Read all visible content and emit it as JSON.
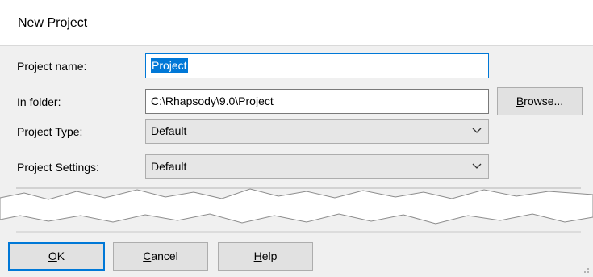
{
  "dialog": {
    "title": "New Project"
  },
  "fields": {
    "project_name_label": "Project name:",
    "project_name_value": "Project",
    "in_folder_label": "In folder:",
    "in_folder_value": "C:\\Rhapsody\\9.0\\Project",
    "project_type_label": "Project Type:",
    "project_type_value": "Default",
    "project_settings_label": "Project Settings:",
    "project_settings_value": "Default"
  },
  "buttons": {
    "browse": {
      "before": "",
      "mnemonic": "B",
      "after": "rowse..."
    },
    "ok": {
      "before": "",
      "mnemonic": "O",
      "after": "K"
    },
    "cancel": {
      "before": "",
      "mnemonic": "C",
      "after": "ancel"
    },
    "help": {
      "before": "",
      "mnemonic": "H",
      "after": "elp"
    }
  },
  "colors": {
    "accent": "#0078d7",
    "dialog_bg": "#f0f0f0"
  }
}
